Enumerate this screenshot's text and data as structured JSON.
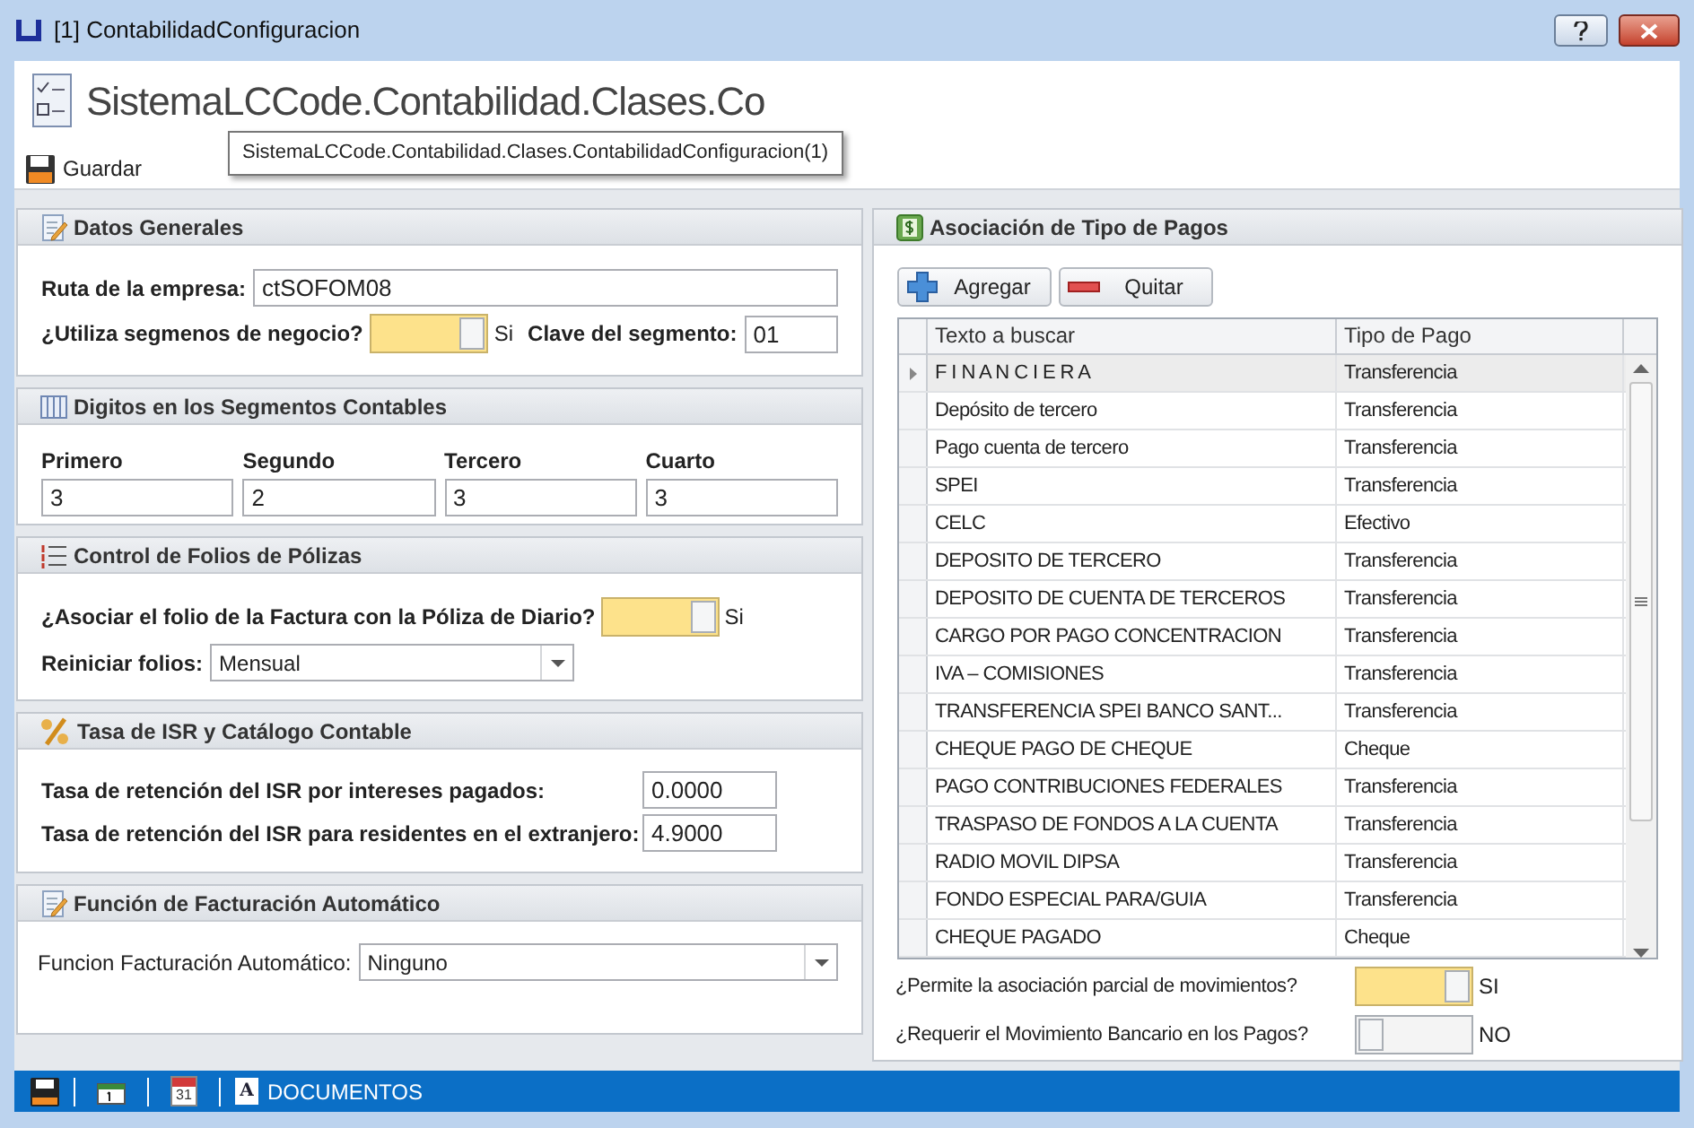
{
  "window": {
    "title": "[1] ContabilidadConfiguracion"
  },
  "header": {
    "title": "SistemaLCCode.Contabilidad.Clases.Co",
    "tooltip": "SistemaLCCode.Contabilidad.Clases.ContabilidadConfiguracion(1)"
  },
  "toolbar": [
    {
      "label": "Guardar"
    }
  ],
  "datos_generales": {
    "title": "Datos Generales",
    "ruta_label": "Ruta de la empresa:",
    "ruta_value": "ctSOFOM08",
    "segmentos_label": "¿Utiliza segmenos de negocio?",
    "segmentos_toggle": {
      "on": true,
      "text": "Si"
    },
    "clave_label": "Clave del segmento:",
    "clave_value": "01"
  },
  "digitos": {
    "title": "Digitos en los Segmentos Contables",
    "fields": [
      {
        "label": "Primero",
        "value": "3"
      },
      {
        "label": "Segundo",
        "value": "2"
      },
      {
        "label": "Tercero",
        "value": "3"
      },
      {
        "label": "Cuarto",
        "value": "3"
      }
    ]
  },
  "folios": {
    "title": "Control de Folios de Pólizas",
    "asociar_label": "¿Asociar el folio de la Factura con la Póliza de Diario?",
    "asociar_toggle": {
      "on": true,
      "text": "Si"
    },
    "reiniciar_label": "Reiniciar folios:",
    "reiniciar_value": "Mensual"
  },
  "isr": {
    "title": "Tasa de ISR y Catálogo Contable",
    "fields": [
      {
        "label": "Tasa de retención del ISR por intereses pagados:",
        "value": "0.0000"
      },
      {
        "label": "Tasa de retención del ISR para residentes en el extranjero:",
        "value": "4.9000"
      }
    ]
  },
  "facturacion": {
    "title": "Función de Facturación Automático",
    "label": "Funcion Facturación Automático:",
    "value": "Ninguno"
  },
  "tipo_pagos": {
    "title": "Asociación de Tipo de Pagos",
    "buttons": [
      {
        "label": "Agregar",
        "kind": "add"
      },
      {
        "label": "Quitar",
        "kind": "remove"
      }
    ],
    "columns": [
      "Texto a buscar",
      "Tipo de Pago"
    ],
    "rows": [
      {
        "cells": [
          "F I N A N C I E R A",
          "Transferencia"
        ],
        "selected": true
      },
      {
        "cells": [
          "Depósito de tercero",
          "Transferencia"
        ],
        "selected": false
      },
      {
        "cells": [
          "Pago cuenta de tercero",
          "Transferencia"
        ],
        "selected": false
      },
      {
        "cells": [
          "SPEI",
          "Transferencia"
        ],
        "selected": false
      },
      {
        "cells": [
          "CELC",
          "Efectivo"
        ],
        "selected": false
      },
      {
        "cells": [
          "DEPOSITO DE TERCERO",
          "Transferencia"
        ],
        "selected": false
      },
      {
        "cells": [
          "DEPOSITO DE CUENTA DE TERCEROS",
          "Transferencia"
        ],
        "selected": false
      },
      {
        "cells": [
          "CARGO POR PAGO CONCENTRACION",
          "Transferencia"
        ],
        "selected": false
      },
      {
        "cells": [
          "IVA – COMISIONES",
          "Transferencia"
        ],
        "selected": false
      },
      {
        "cells": [
          "TRANSFERENCIA SPEI BANCO SANT...",
          "Transferencia"
        ],
        "selected": false
      },
      {
        "cells": [
          "CHEQUE PAGO DE CHEQUE",
          "Cheque"
        ],
        "selected": false
      },
      {
        "cells": [
          "PAGO CONTRIBUCIONES FEDERALES",
          "Transferencia"
        ],
        "selected": false
      },
      {
        "cells": [
          "TRASPASO DE FONDOS A LA CUENTA",
          "Transferencia"
        ],
        "selected": false
      },
      {
        "cells": [
          "RADIO MOVIL DIPSA",
          "Transferencia"
        ],
        "selected": false
      },
      {
        "cells": [
          "FONDO ESPECIAL PARA/GUIA",
          "Transferencia"
        ],
        "selected": false
      },
      {
        "cells": [
          "CHEQUE PAGADO",
          "Cheque"
        ],
        "selected": false
      }
    ],
    "options": [
      {
        "label": "¿Permite la asociación parcial de movimientos?",
        "toggle": {
          "on": true,
          "text": "SI"
        }
      },
      {
        "label": "¿Requerir el Movimiento Bancario en los Pagos?",
        "toggle": {
          "on": false,
          "text": "NO"
        }
      }
    ]
  },
  "bottom_bar": {
    "calendar_day": "31",
    "documents_letter": "A",
    "documents_label": "DOCUMENTOS"
  }
}
